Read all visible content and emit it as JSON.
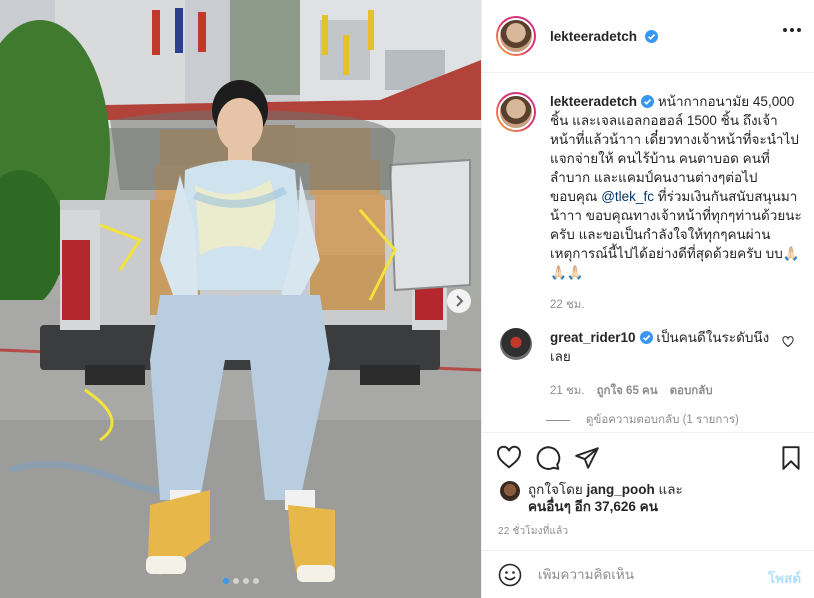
{
  "post": {
    "username": "lekteeradetch",
    "verified": true,
    "photo_alt": "Man in tie-dye t-shirt and jeans sitting on the tailgate of a pickup truck loaded with boxes",
    "carousel": {
      "total": 4,
      "active": 1
    }
  },
  "caption": {
    "username": "lekteeradetch",
    "text_1": "หน้ากากอนามัย 45,000 ชิ้น และเจลแอลกอฮอล์ 1500 ชิ้น ถึงเจ้าหน้าที่แล้วน้าาา เดี๋ยวทางเจ้าหน้าที่จะนำไปแจกจ่ายให้ คนไร้บ้าน คนตาบอด คนที่ลำบาก และแคมป์คนงานต่างๆต่อไป ขอบคุณ ",
    "mention": "@tlek_fc",
    "text_2": " ที่ร่วมเงินกันสนับสนุนมาน้าาา ขอบคุณทางเจ้าหน้าที่ทุกๆท่านด้วยนะครับ และขอเป็นกำลังใจให้ทุกๆคนผ่านเหตุการณ์นี้ไปได้อย่างดีที่สุดด้วยครับ บบ🙏🏻🙏🏻🙏🏻",
    "time": "22 ชม."
  },
  "reply": {
    "username": "great_rider10",
    "verified": true,
    "text": "เป็นคนดีในระดับนึงเลย",
    "time": "21 ชม.",
    "likes": "ถูกใจ 65 คน",
    "reply_label": "ตอบกลับ",
    "view_replies": "ดูข้อความตอบกลับ (1 รายการ)"
  },
  "likes": {
    "prefix": "ถูกใจโดย ",
    "first_liker": "jang_pooh",
    "middle": " และ",
    "others": "คนอื่นๆ อีก 37,626 คน"
  },
  "post_time": "22 ชั่วโมงที่แล้ว",
  "comment_box": {
    "placeholder": "เพิ่มความคิดเห็น",
    "post_label": "โพสต์"
  },
  "icons": {
    "more": "more-options-icon",
    "like": "heart-icon",
    "comment": "comment-icon",
    "share": "send-icon",
    "save": "bookmark-icon",
    "emoji": "emoji-icon",
    "next": "chevron-right-icon"
  },
  "colors": {
    "verified": "#3897f0",
    "muted": "#8e8e8e",
    "link": "#00376b",
    "post_disabled": "#b2dffc"
  }
}
